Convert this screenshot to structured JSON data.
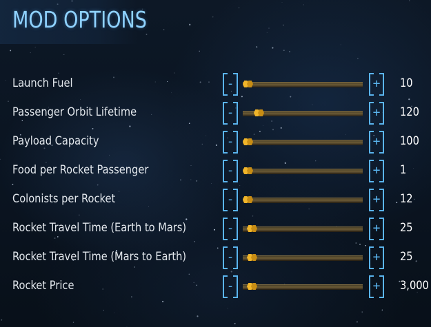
{
  "title": "MOD OPTIONS",
  "colors": {
    "title": "#8fd2ff",
    "bracket": "#5ab4ee",
    "thumb": "#e0a51f",
    "label": "#e2e7ec"
  },
  "icons": {
    "thumb": "hexagon-slider-knob-icon"
  },
  "controls": {
    "decrease_label": "-",
    "increase_label": "+"
  },
  "options": [
    {
      "label": "Launch Fuel",
      "value": "10",
      "slider_fraction": 0.0
    },
    {
      "label": "Passenger Orbit Lifetime",
      "value": "120",
      "slider_fraction": 0.1
    },
    {
      "label": "Payload Capacity",
      "value": "100",
      "slider_fraction": 0.0
    },
    {
      "label": "Food per Rocket Passenger",
      "value": "1",
      "slider_fraction": 0.0
    },
    {
      "label": "Colonists per Rocket",
      "value": "12",
      "slider_fraction": 0.0
    },
    {
      "label": "Rocket Travel Time (Earth to Mars)",
      "value": "25",
      "slider_fraction": 0.04
    },
    {
      "label": "Rocket Travel Time (Mars to Earth)",
      "value": "25",
      "slider_fraction": 0.04
    },
    {
      "label": "Rocket Price",
      "value": "3,000",
      "slider_fraction": 0.04
    }
  ]
}
